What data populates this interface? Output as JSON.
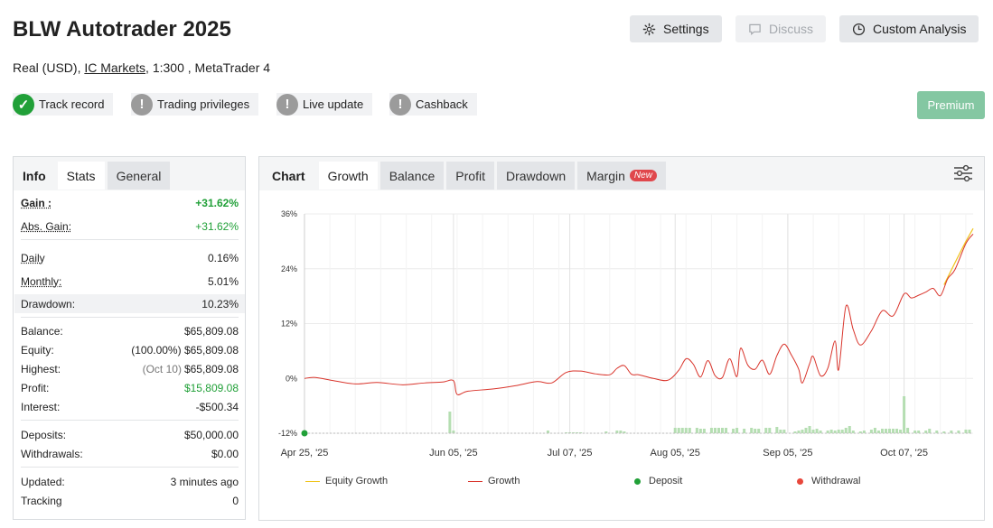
{
  "header": {
    "title": "BLW Autotrader 2025",
    "account_type": "Real (USD),",
    "broker": "IC Markets",
    "leverage_platform": ", 1:300 , MetaTrader 4"
  },
  "toolbar": {
    "settings_label": "Settings",
    "discuss_label": "Discuss",
    "custom_analysis_label": "Custom Analysis"
  },
  "badges": [
    {
      "label": "Track record",
      "status": "verified"
    },
    {
      "label": "Trading privileges",
      "status": "unverified"
    },
    {
      "label": "Live update",
      "status": "unverified"
    },
    {
      "label": "Cashback",
      "status": "unverified"
    }
  ],
  "premium_label": "Premium",
  "left_tabs": {
    "info": "Info",
    "stats": "Stats",
    "general": "General"
  },
  "stats": {
    "gain_label": "Gain :",
    "gain_value": "+31.62%",
    "abs_gain_label": "Abs. Gain:",
    "abs_gain_value": "+31.62%",
    "daily_label": "Daily",
    "daily_value": "0.16%",
    "monthly_label": "Monthly:",
    "monthly_value": "5.01%",
    "drawdown_label": "Drawdown:",
    "drawdown_value": "10.23%",
    "balance_label": "Balance:",
    "balance_value": "$65,809.08",
    "equity_label": "Equity:",
    "equity_pct": "(100.00%)",
    "equity_value": "$65,809.08",
    "highest_label": "Highest:",
    "highest_date": "(Oct 10)",
    "highest_value": "$65,809.08",
    "profit_label": "Profit:",
    "profit_value": "$15,809.08",
    "interest_label": "Interest:",
    "interest_value": "-$500.34",
    "deposits_label": "Deposits:",
    "deposits_value": "$50,000.00",
    "withdrawals_label": "Withdrawals:",
    "withdrawals_value": "$0.00",
    "updated_label": "Updated:",
    "updated_value": "3 minutes ago",
    "tracking_label": "Tracking",
    "tracking_value": "0"
  },
  "chart_tabs": {
    "chart": "Chart",
    "growth": "Growth",
    "balance": "Balance",
    "profit": "Profit",
    "drawdown": "Drawdown",
    "margin": "Margin",
    "new_badge": "New"
  },
  "colors": {
    "growth": "#d9342b",
    "equity": "#f0c419",
    "deposit": "#21a038",
    "withdrawal": "#e8473b",
    "bars": "#b5deb2"
  },
  "chart_data": {
    "type": "line",
    "y_ticks": [
      "36%",
      "24%",
      "12%",
      "0%",
      "-12%"
    ],
    "ylim": [
      -12,
      36
    ],
    "x_ticks": [
      "Apr 25, '25",
      "Jun 05, '25",
      "Jul 07, '25",
      "Aug 05, '25",
      "Sep 05, '25",
      "Oct 07, '25"
    ],
    "growth_points": [
      [
        0,
        0.0
      ],
      [
        3,
        0.2
      ],
      [
        8,
        -0.5
      ],
      [
        14,
        -1.2
      ],
      [
        20,
        -0.9
      ],
      [
        27,
        -1.4
      ],
      [
        33,
        -1.0
      ],
      [
        38,
        -0.8
      ],
      [
        41,
        -0.5
      ],
      [
        42,
        -3.5
      ],
      [
        45,
        -2.8
      ],
      [
        52,
        -2.3
      ],
      [
        58,
        -1.6
      ],
      [
        64,
        -0.7
      ],
      [
        68,
        -1.0
      ],
      [
        72,
        1.3
      ],
      [
        76,
        1.6
      ],
      [
        80,
        1.0
      ],
      [
        84,
        0.8
      ],
      [
        86,
        2.2
      ],
      [
        88,
        2.8
      ],
      [
        90,
        0.9
      ],
      [
        92,
        0.8
      ],
      [
        96,
        0.0
      ],
      [
        100,
        -0.4
      ],
      [
        103,
        1.8
      ],
      [
        105,
        4.3
      ],
      [
        107,
        3.1
      ],
      [
        109,
        0.3
      ],
      [
        111,
        3.9
      ],
      [
        113,
        0.6
      ],
      [
        115,
        0.2
      ],
      [
        117,
        4.3
      ],
      [
        119,
        0.4
      ],
      [
        120,
        6.6
      ],
      [
        122,
        2.9
      ],
      [
        124,
        2.0
      ],
      [
        126,
        4.0
      ],
      [
        128,
        0.9
      ],
      [
        130,
        5.0
      ],
      [
        132,
        7.5
      ],
      [
        134,
        5.1
      ],
      [
        136,
        2.0
      ],
      [
        137,
        -1.0
      ],
      [
        139,
        3.2
      ],
      [
        140,
        4.8
      ],
      [
        142,
        0.6
      ],
      [
        144,
        2.2
      ],
      [
        146,
        8.2
      ],
      [
        147,
        1.9
      ],
      [
        149,
        15.8
      ],
      [
        151,
        10.7
      ],
      [
        153,
        7.3
      ],
      [
        156,
        10.4
      ],
      [
        159,
        14.8
      ],
      [
        162,
        13.7
      ],
      [
        165,
        18.5
      ],
      [
        167,
        17.6
      ],
      [
        169,
        18.2
      ],
      [
        171,
        18.9
      ],
      [
        173,
        19.7
      ],
      [
        175,
        18.1
      ],
      [
        177,
        21.8
      ],
      [
        179,
        23.8
      ],
      [
        182,
        29.5
      ],
      [
        184,
        31.6
      ]
    ],
    "equity_points": [
      [
        176,
        20.5
      ],
      [
        179,
        25.3
      ],
      [
        182,
        30.0
      ],
      [
        184,
        32.8
      ]
    ],
    "deposit": {
      "x": 0,
      "value": -12
    },
    "bar_heights": [
      [
        40,
        24
      ],
      [
        41,
        3
      ],
      [
        67,
        3
      ],
      [
        72,
        1
      ],
      [
        73,
        1
      ],
      [
        74,
        1
      ],
      [
        75,
        1
      ],
      [
        76,
        1
      ],
      [
        83,
        2
      ],
      [
        86,
        3
      ],
      [
        87,
        3
      ],
      [
        88,
        2
      ],
      [
        102,
        6
      ],
      [
        103,
        6
      ],
      [
        104,
        6
      ],
      [
        105,
        6
      ],
      [
        106,
        6
      ],
      [
        108,
        6
      ],
      [
        109,
        5
      ],
      [
        110,
        5
      ],
      [
        112,
        6
      ],
      [
        113,
        6
      ],
      [
        114,
        6
      ],
      [
        115,
        6
      ],
      [
        116,
        6
      ],
      [
        118,
        5
      ],
      [
        119,
        6
      ],
      [
        121,
        5
      ],
      [
        123,
        6
      ],
      [
        124,
        5
      ],
      [
        125,
        5
      ],
      [
        127,
        6
      ],
      [
        128,
        6
      ],
      [
        130,
        7
      ],
      [
        131,
        4
      ],
      [
        132,
        4
      ],
      [
        135,
        2
      ],
      [
        136,
        3
      ],
      [
        137,
        4
      ],
      [
        138,
        6
      ],
      [
        139,
        8
      ],
      [
        140,
        4
      ],
      [
        141,
        5
      ],
      [
        142,
        3
      ],
      [
        144,
        3
      ],
      [
        145,
        4
      ],
      [
        146,
        3
      ],
      [
        147,
        4
      ],
      [
        148,
        4
      ],
      [
        149,
        6
      ],
      [
        150,
        8
      ],
      [
        151,
        3
      ],
      [
        153,
        2
      ],
      [
        154,
        3
      ],
      [
        156,
        4
      ],
      [
        157,
        6
      ],
      [
        158,
        3
      ],
      [
        159,
        5
      ],
      [
        160,
        5
      ],
      [
        161,
        5
      ],
      [
        162,
        5
      ],
      [
        163,
        5
      ],
      [
        164,
        4
      ],
      [
        165,
        41
      ],
      [
        166,
        6
      ],
      [
        168,
        3
      ],
      [
        169,
        3
      ],
      [
        171,
        3
      ],
      [
        172,
        5
      ],
      [
        174,
        3
      ],
      [
        176,
        2
      ],
      [
        178,
        3
      ],
      [
        180,
        3
      ],
      [
        182,
        4
      ],
      [
        183,
        4
      ]
    ],
    "x_days": 184,
    "legend": [
      "Equity Growth",
      "Growth",
      "Deposit",
      "Withdrawal"
    ]
  }
}
